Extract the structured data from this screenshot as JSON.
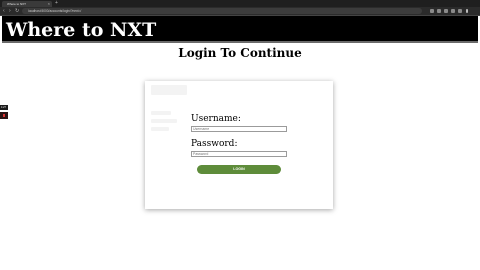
{
  "browser": {
    "tab_title": "Where to NXT",
    "tab_close": "×",
    "new_tab": "+",
    "url": "localhost:5000/accounts/login/?next=/"
  },
  "header": {
    "site_title": "Where to NXT"
  },
  "page": {
    "heading": "Login To Continue"
  },
  "sidebar": {
    "badge": "4 27"
  },
  "form": {
    "username_label": "Username:",
    "username_placeholder": "Username",
    "password_label": "Password:",
    "password_placeholder": "Password",
    "login_label": "LOGIN"
  },
  "colors": {
    "header_bg": "#000000",
    "button_bg": "#5e8c3a"
  }
}
